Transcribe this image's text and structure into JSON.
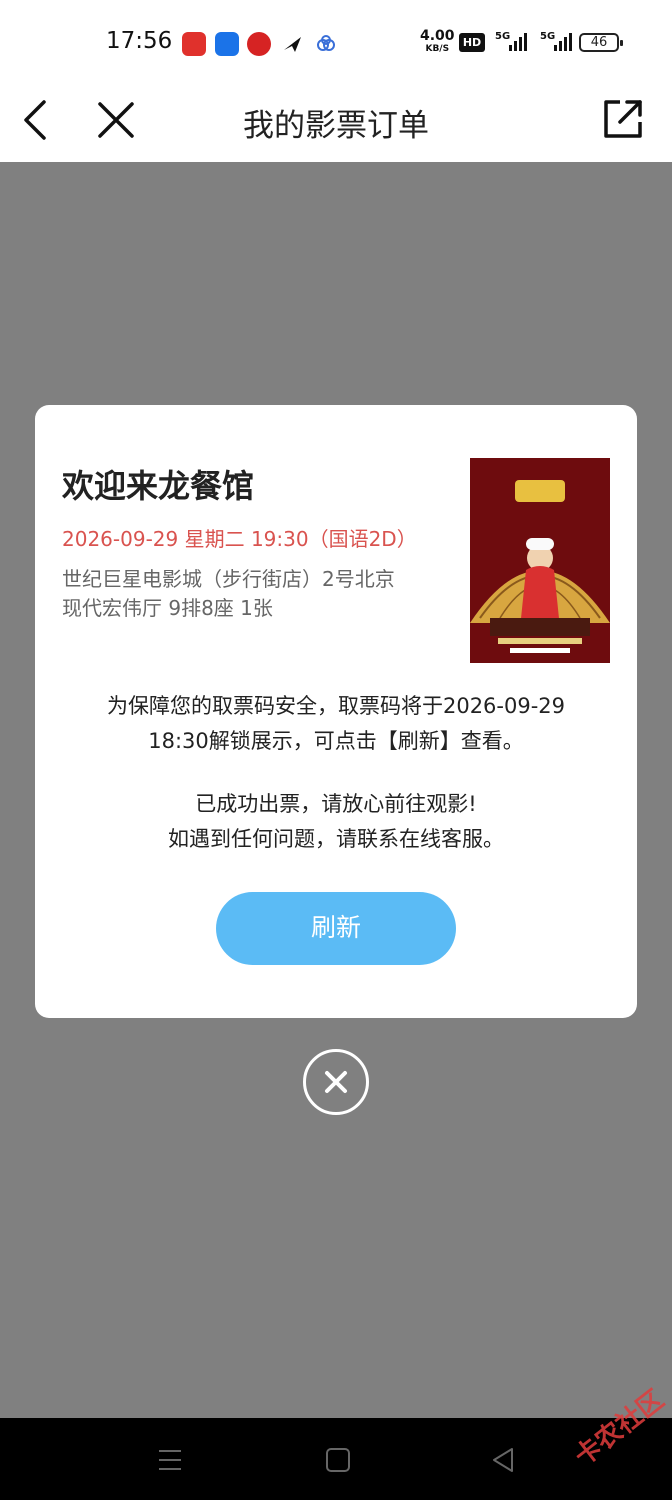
{
  "status_bar": {
    "time": "17:56",
    "net_speed": "4.00",
    "net_speed_unit": "KB/S",
    "hd_label": "HD",
    "sig1_label": "5G",
    "sig2_label": "5G",
    "battery": "46"
  },
  "nav": {
    "title": "我的影票订单",
    "icons": [
      "back-icon",
      "close-icon",
      "share-icon"
    ]
  },
  "ticket": {
    "movie_title": "欢迎来龙餐馆",
    "showtime": "2026-09-29 星期二 19:30（国语2D）",
    "cinema_line1": "世纪巨星电影城（步行街店）2号北京",
    "cinema_line2": "现代宏伟厅 9排8座 1张",
    "notice_line1": "为保障您的取票码安全，取票码将于2026-09-29",
    "notice_line2": "18:30解锁展示，可点击【刷新】查看。",
    "success_line1": "已成功出票，请放心前往观影!",
    "success_line2": "如遇到任何问题，请联系在线客服。",
    "refresh_label": "刷新"
  },
  "colors": {
    "accent": "#5bbbf5",
    "showtime": "#d9534f",
    "overlay": "#808080"
  },
  "watermark": "卡农社区"
}
